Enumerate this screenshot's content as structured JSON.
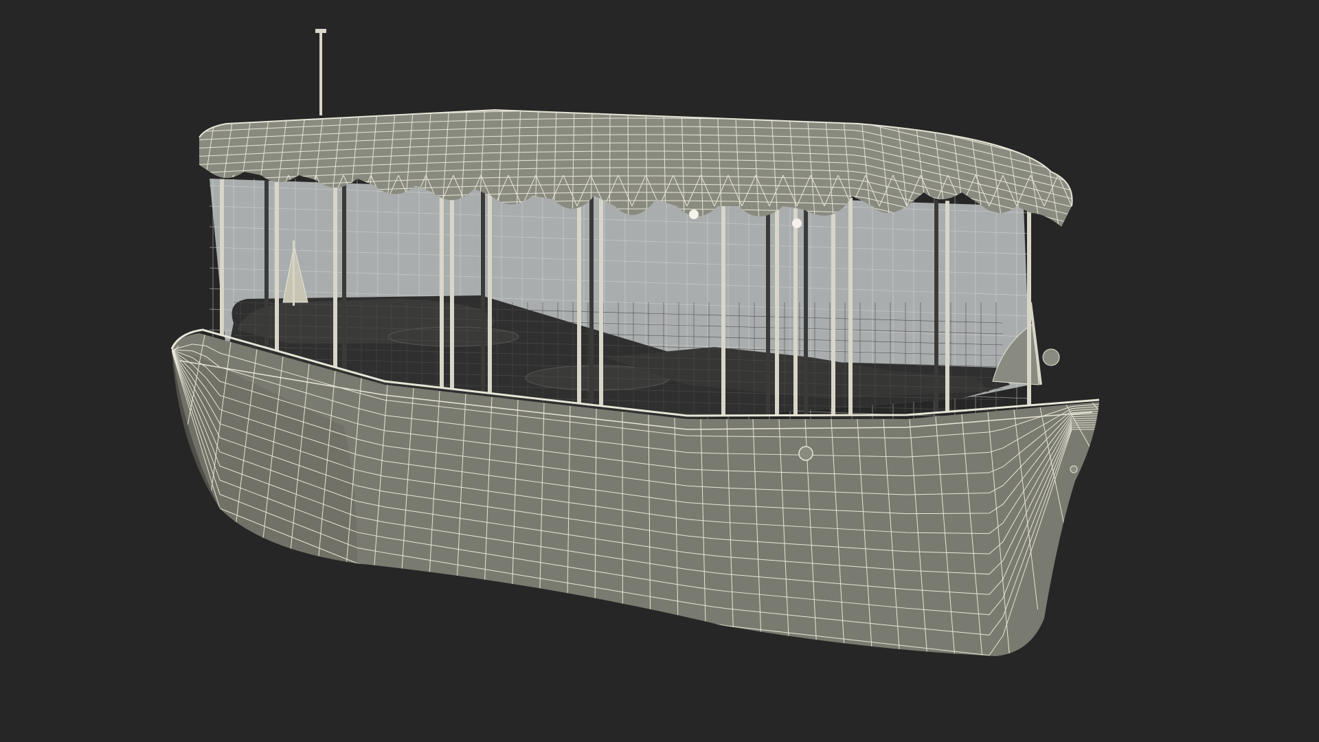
{
  "scene": {
    "subject": "electric-launch-boat",
    "render_style": "wireframe-over-shaded",
    "colors": {
      "background": "#262626",
      "hull_fill": "#7a7b70",
      "hull_shade": "#6a6b61",
      "canopy_fill": "#8a8b80",
      "wire": "#e8e6d8",
      "glass": "#b9bcbd",
      "interior": "#2e2f2e",
      "interior_light": "#3a3b39",
      "post": "#d8d6c8",
      "post_dark": "#3a3a38"
    }
  }
}
